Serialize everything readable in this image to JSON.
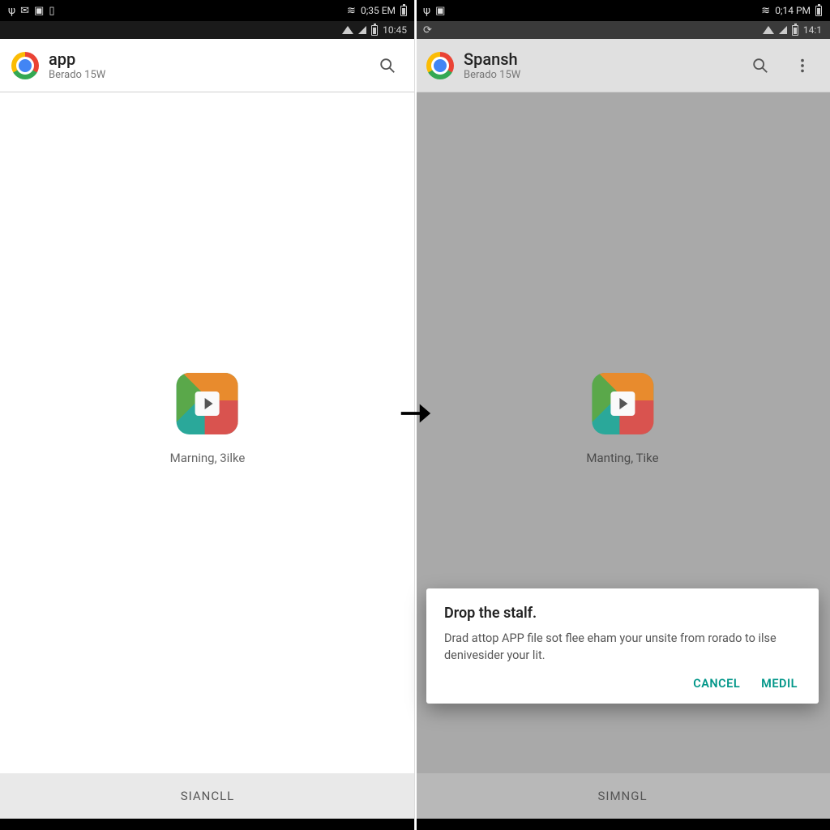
{
  "left": {
    "status_top": {
      "time": "0;35 EM"
    },
    "status_mid": {
      "clock": "10:45"
    },
    "app_bar": {
      "title": "app",
      "subtitle": "Berado 15W"
    },
    "tile": {
      "label": "Marning, 3ilke"
    },
    "bottom": {
      "label": "SIANCLL"
    }
  },
  "right": {
    "status_top": {
      "time": "0;14 PM"
    },
    "status_mid": {
      "clock": "14:1"
    },
    "app_bar": {
      "title": "Spansh",
      "subtitle": "Berado 15W"
    },
    "tile": {
      "label": "Manting, Tike"
    },
    "bottom": {
      "label": "SIMNGL"
    },
    "dialog": {
      "title": "Drop the stalf.",
      "body": "Drad attop APP file sot flee eham your unsite from rorado to ilse denivesider your lit.",
      "cancel": "CANCEL",
      "confirm": "MEDIL"
    }
  }
}
